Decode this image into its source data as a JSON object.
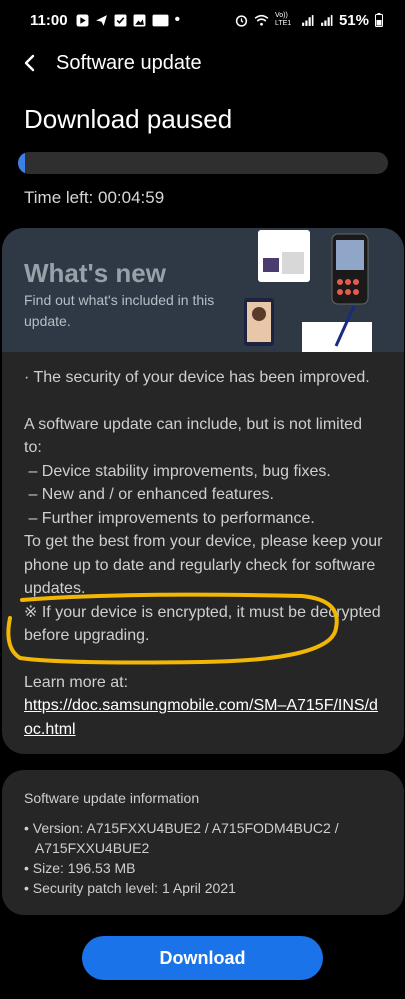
{
  "status_bar": {
    "time": "11:00",
    "battery": "51%",
    "lte_label": "Vo)) LTE1"
  },
  "appbar": {
    "title": "Software update"
  },
  "status": {
    "title": "Download paused",
    "progress_fraction": 0.02,
    "time_left": "Time left: 00:04:59"
  },
  "whats_new": {
    "title": "What's new",
    "subtitle": "Find out what's included in this update."
  },
  "notes": {
    "line1": "· The security of your device has been improved.",
    "para_intro": "A software update can include, but is not limited to:",
    "bullet1": " – Device stability improvements, bug fixes.",
    "bullet2": " – New and / or enhanced features.",
    "bullet3": " – Further improvements to performance.",
    "keep_up": "To get the best from your device, please keep your phone up to date and regularly check for software updates.",
    "encrypted": "※ If your device is encrypted, it must be decrypted before upgrading.",
    "learn_more": "Learn more at:",
    "link": "https://doc.samsungmobile.com/SM–A715F/INS/doc.html"
  },
  "info": {
    "title": "Software update information",
    "version": "• Version: A715FXXU4BUE2 / A715FODM4BUC2 /",
    "version_cont": "   A715FXXU4BUE2",
    "size": "• Size: 196.53 MB",
    "patch": "• Security patch level: 1 April 2021"
  },
  "download_label": "Download",
  "colors": {
    "accent": "#1a73e8",
    "highlight": "#f2b705"
  }
}
